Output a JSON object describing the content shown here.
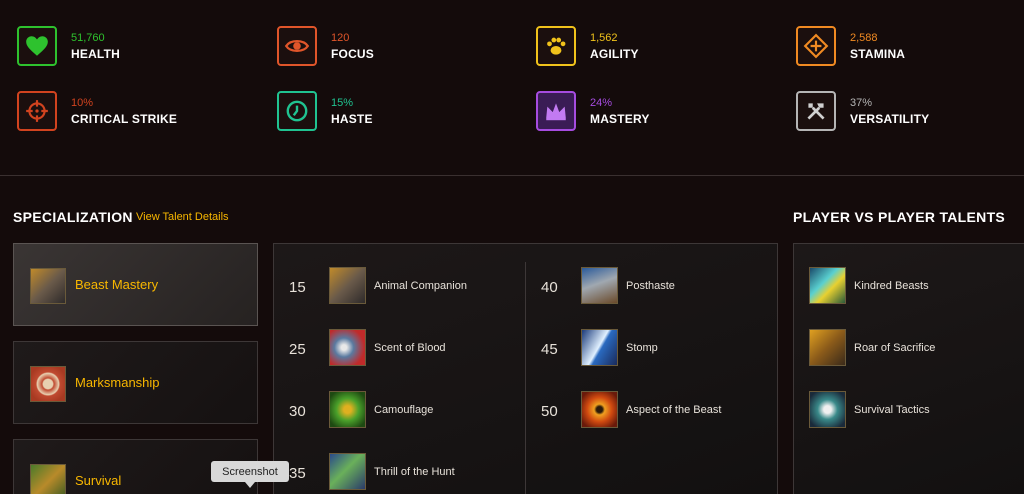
{
  "stats": [
    {
      "value": "51,760",
      "name": "HEALTH",
      "icon": "heart-icon",
      "color": "#2ec22e"
    },
    {
      "value": "120",
      "name": "FOCUS",
      "icon": "eye-icon",
      "color": "#e0552a"
    },
    {
      "value": "1,562",
      "name": "AGILITY",
      "icon": "paw-icon",
      "color": "#f0c21b"
    },
    {
      "value": "2,588",
      "name": "STAMINA",
      "icon": "stamina-icon",
      "color": "#f08a22"
    },
    {
      "value": "10%",
      "name": "CRITICAL STRIKE",
      "icon": "crosshair-icon",
      "color": "#d2431f"
    },
    {
      "value": "15%",
      "name": "HASTE",
      "icon": "clock-icon",
      "color": "#20c391"
    },
    {
      "value": "24%",
      "name": "MASTERY",
      "icon": "crown-icon",
      "color": "#a64ce0"
    },
    {
      "value": "37%",
      "name": "VERSATILITY",
      "icon": "tools-icon",
      "color": "#b5b5b5"
    }
  ],
  "specialization": {
    "title": "SPECIALIZATION",
    "link": "View Talent Details",
    "specs": [
      {
        "label": "Beast Mastery",
        "icon": "beast-mastery-icon",
        "active": true
      },
      {
        "label": "Marksmanship",
        "icon": "marksmanship-icon",
        "active": false
      },
      {
        "label": "Survival",
        "icon": "survival-icon",
        "active": false
      }
    ]
  },
  "talents": {
    "left": [
      {
        "level": "15",
        "name": "Animal Companion",
        "icon": "animal-companion-icon"
      },
      {
        "level": "25",
        "name": "Scent of Blood",
        "icon": "scent-of-blood-icon"
      },
      {
        "level": "30",
        "name": "Camouflage",
        "icon": "camouflage-icon"
      },
      {
        "level": "35",
        "name": "Thrill of the Hunt",
        "icon": "thrill-of-the-hunt-icon"
      }
    ],
    "right": [
      {
        "level": "40",
        "name": "Posthaste",
        "icon": "posthaste-icon"
      },
      {
        "level": "45",
        "name": "Stomp",
        "icon": "stomp-icon"
      },
      {
        "level": "50",
        "name": "Aspect of the Beast",
        "icon": "aspect-of-the-beast-icon"
      }
    ]
  },
  "pvp": {
    "title": "PLAYER VS PLAYER TALENTS",
    "talents": [
      {
        "name": "Kindred Beasts",
        "icon": "kindred-beasts-icon"
      },
      {
        "name": "Roar of Sacrifice",
        "icon": "roar-of-sacrifice-icon"
      },
      {
        "name": "Survival Tactics",
        "icon": "survival-tactics-icon"
      }
    ]
  },
  "tooltip": "Screenshot"
}
